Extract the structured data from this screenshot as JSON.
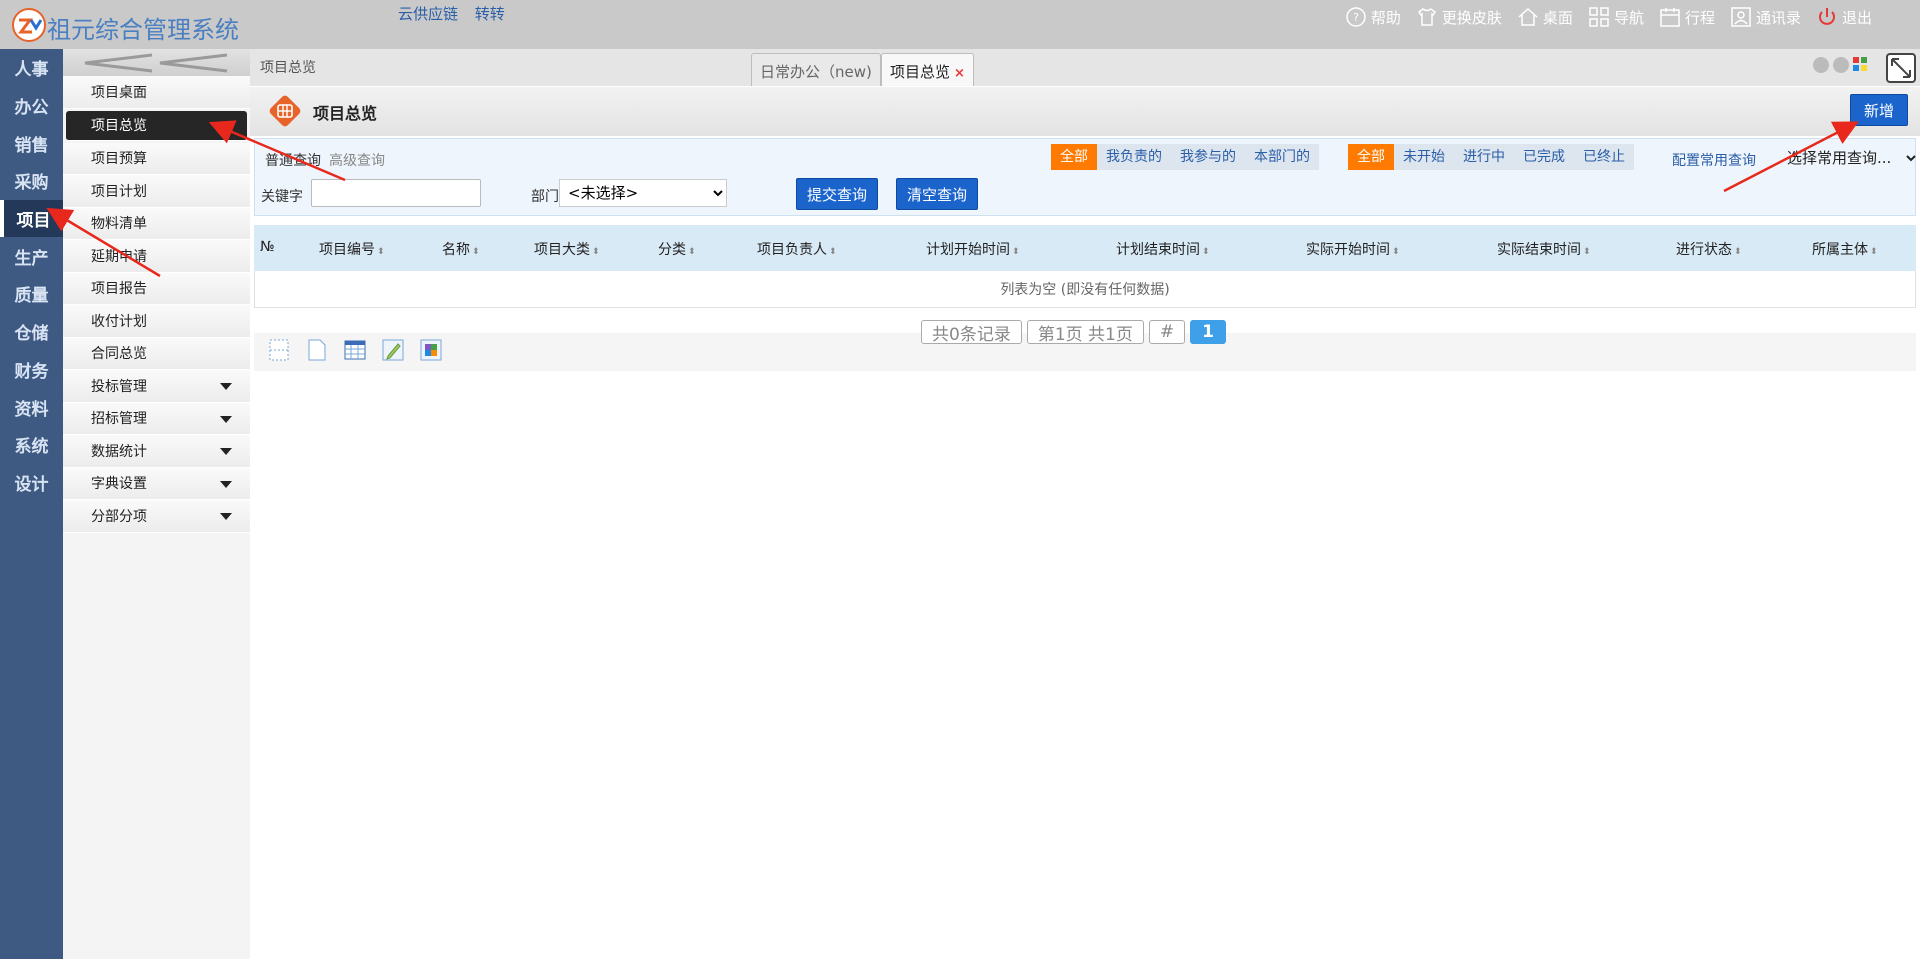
{
  "app": {
    "title": "祖元综合管理系统"
  },
  "top_links": [
    "云供应链",
    "转转"
  ],
  "top_nav": [
    {
      "label": "帮助",
      "icon": "help-icon"
    },
    {
      "label": "更换皮肤",
      "icon": "shirt-icon"
    },
    {
      "label": "桌面",
      "icon": "home-icon"
    },
    {
      "label": "导航",
      "icon": "grid-icon"
    },
    {
      "label": "行程",
      "icon": "calendar-icon"
    },
    {
      "label": "通讯录",
      "icon": "contacts-icon"
    },
    {
      "label": "退出",
      "icon": "power-icon"
    }
  ],
  "modules": [
    "人事",
    "办公",
    "销售",
    "采购",
    "项目",
    "生产",
    "质量",
    "仓储",
    "财务",
    "资料",
    "系统",
    "设计"
  ],
  "active_module": "项目",
  "submenu": [
    "项目桌面",
    "项目总览",
    "项目预算",
    "项目计划",
    "物料清单",
    "延期申请",
    "项目报告",
    "收付计划",
    "合同总览",
    "投标管理",
    "招标管理",
    "数据统计",
    "字典设置",
    "分部分项"
  ],
  "active_submenu": "项目总览",
  "breadcrumb": "项目总览",
  "tabs": [
    {
      "label": "日常办公（new)"
    },
    {
      "label": "项目总览",
      "close": "×"
    }
  ],
  "page": {
    "title": "项目总览",
    "add_label": "新增"
  },
  "search": {
    "types": [
      "普通查询",
      "高级查询"
    ],
    "scope_filters": [
      "全部",
      "我负责的",
      "我参与的",
      "本部门的"
    ],
    "status_filters": [
      "全部",
      "未开始",
      "进行中",
      "已完成",
      "已终止"
    ],
    "config_label": "配置常用查询",
    "common_query_placeholder": "选择常用查询...",
    "keyword_label": "关键字",
    "keyword_value": "",
    "dept_label": "部门",
    "dept_value": "<未选择>",
    "submit_label": "提交查询",
    "clear_label": "清空查询"
  },
  "table": {
    "columns": [
      "№",
      "项目编号",
      "名称",
      "项目大类",
      "分类",
      "项目负责人",
      "计划开始时间",
      "计划结束时间",
      "实际开始时间",
      "实际结束时间",
      "进行状态",
      "所属主体"
    ],
    "empty_text": "列表为空 (即没有任何数据)"
  },
  "pager": {
    "total": "共0条记录",
    "page_info": "第1页 共1页",
    "jump": "#",
    "current": "1"
  },
  "colors": {
    "accent": "#1b64cc",
    "orange": "#ff7a00",
    "sidebar": "#3e5a82"
  }
}
